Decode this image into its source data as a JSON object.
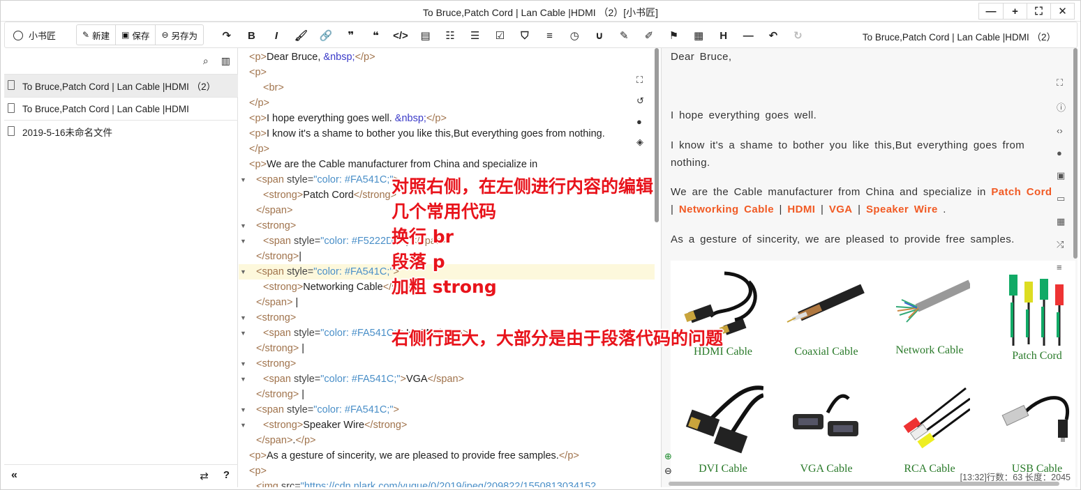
{
  "window": {
    "title": "To Bruce,Patch Cord | Lan Cable |HDMI （2）[小书匠]",
    "controls": [
      "—",
      "+",
      "⛶",
      "✕"
    ]
  },
  "toolbar": {
    "logo_label": "小书匠",
    "new_label": "新建",
    "save_label": "保存",
    "saveas_label": "另存为",
    "doc_title": "To Bruce,Patch Cord | Lan Cable |HDMI （2）",
    "tools": [
      {
        "name": "redo-arrow-icon",
        "glyph": "↷"
      },
      {
        "name": "bold-icon",
        "glyph": "B"
      },
      {
        "name": "italic-icon",
        "glyph": "I"
      },
      {
        "name": "brush-icon",
        "glyph": "🖌"
      },
      {
        "name": "link-icon",
        "glyph": "🔗"
      },
      {
        "name": "quote-icon",
        "glyph": "❞"
      },
      {
        "name": "quote-left-icon",
        "glyph": "❝"
      },
      {
        "name": "code-icon",
        "glyph": "</>"
      },
      {
        "name": "file-code-icon",
        "glyph": "▤"
      },
      {
        "name": "ordered-list-icon",
        "glyph": "☷"
      },
      {
        "name": "unordered-list-icon",
        "glyph": "☰"
      },
      {
        "name": "task-list-icon",
        "glyph": "☑"
      },
      {
        "name": "html5-icon",
        "glyph": "⛉"
      },
      {
        "name": "align-icon",
        "glyph": "≡"
      },
      {
        "name": "clock-icon",
        "glyph": "◷"
      },
      {
        "name": "magnet-icon",
        "glyph": "∪"
      },
      {
        "name": "note-edit-icon",
        "glyph": "✎"
      },
      {
        "name": "note-edit-2-icon",
        "glyph": "✐"
      },
      {
        "name": "flag-icon",
        "glyph": "⚑"
      },
      {
        "name": "table-icon",
        "glyph": "▦"
      },
      {
        "name": "heading-icon",
        "glyph": "H"
      },
      {
        "name": "horizontal-rule-icon",
        "glyph": "—"
      },
      {
        "name": "undo-icon",
        "glyph": "↶"
      },
      {
        "name": "redo-icon",
        "glyph": "↻"
      }
    ]
  },
  "sidebar": {
    "files": [
      {
        "label": "To Bruce,Patch Cord | Lan Cable |HDMI （2）",
        "active": true
      },
      {
        "label": "To Bruce,Patch Cord | Lan Cable |HDMI",
        "active": false
      },
      {
        "label": "2019-5-16未命名文件",
        "active": false
      }
    ],
    "collapse": "«",
    "swap": "⇄",
    "help": "?"
  },
  "editor": {
    "lines": [
      {
        "arrow": false,
        "indent": 0,
        "parts": [
          [
            "tag",
            "<p>"
          ],
          [
            "txt",
            "Dear Bruce, "
          ],
          [
            "ent",
            "&nbsp;"
          ],
          [
            "tag",
            "</p>"
          ]
        ]
      },
      {
        "arrow": false,
        "indent": 0,
        "parts": [
          [
            "tag",
            "<p>"
          ]
        ]
      },
      {
        "arrow": false,
        "indent": 2,
        "parts": [
          [
            "tag",
            "<br>"
          ]
        ]
      },
      {
        "arrow": false,
        "indent": 0,
        "parts": [
          [
            "tag",
            "</p>"
          ]
        ]
      },
      {
        "arrow": false,
        "indent": 0,
        "parts": [
          [
            "tag",
            "<p>"
          ],
          [
            "txt",
            "I hope everything goes well. "
          ],
          [
            "ent",
            "&nbsp;"
          ],
          [
            "tag",
            "</p>"
          ]
        ]
      },
      {
        "arrow": false,
        "indent": 0,
        "parts": [
          [
            "tag",
            "<p>"
          ],
          [
            "txt",
            "I know it's a shame to bother you like this,But everything goes from nothing."
          ]
        ]
      },
      {
        "arrow": false,
        "indent": 0,
        "parts": [
          [
            "tag",
            "</p>"
          ]
        ]
      },
      {
        "arrow": false,
        "indent": 0,
        "parts": [
          [
            "tag",
            "<p>"
          ],
          [
            "txt",
            "We are the Cable manufacturer from China and specialize in"
          ]
        ]
      },
      {
        "arrow": true,
        "indent": 1,
        "parts": [
          [
            "tag",
            "<span "
          ],
          [
            "attr",
            "style="
          ],
          [
            "str",
            "\"color: #FA541C;\""
          ],
          [
            "tag",
            ">"
          ]
        ]
      },
      {
        "arrow": false,
        "indent": 2,
        "parts": [
          [
            "tag",
            "<strong>"
          ],
          [
            "txt",
            "Patch Cord"
          ],
          [
            "tag",
            "</strong>"
          ]
        ]
      },
      {
        "arrow": false,
        "indent": 1,
        "parts": [
          [
            "tag",
            "</span>"
          ]
        ]
      },
      {
        "arrow": true,
        "indent": 1,
        "parts": [
          [
            "tag",
            "<strong>"
          ]
        ]
      },
      {
        "arrow": true,
        "indent": 2,
        "parts": [
          [
            "tag",
            "<span "
          ],
          [
            "attr",
            "style="
          ],
          [
            "str",
            "\"color: #F5222D;\""
          ],
          [
            "tag",
            ">"
          ],
          [
            "txt",
            "| "
          ],
          [
            "tag",
            "</span>"
          ]
        ]
      },
      {
        "arrow": false,
        "indent": 1,
        "parts": [
          [
            "tag",
            "</strong>"
          ],
          [
            "txt",
            "|"
          ]
        ]
      },
      {
        "arrow": true,
        "indent": 1,
        "hl": true,
        "parts": [
          [
            "tag",
            "<span "
          ],
          [
            "attr",
            "style="
          ],
          [
            "str",
            "\"color: #FA541C;\""
          ],
          [
            "tag",
            ">"
          ]
        ]
      },
      {
        "arrow": false,
        "indent": 2,
        "parts": [
          [
            "tag",
            "<strong>"
          ],
          [
            "txt",
            "Networking Cable"
          ],
          [
            "tag",
            "</strong>"
          ]
        ]
      },
      {
        "arrow": false,
        "indent": 1,
        "parts": [
          [
            "tag",
            "</span>"
          ],
          [
            "txt",
            " |"
          ]
        ]
      },
      {
        "arrow": true,
        "indent": 1,
        "parts": [
          [
            "tag",
            "<strong>"
          ]
        ]
      },
      {
        "arrow": true,
        "indent": 2,
        "parts": [
          [
            "tag",
            "<span "
          ],
          [
            "attr",
            "style="
          ],
          [
            "str",
            "\"color: #FA541C;\""
          ],
          [
            "tag",
            ">"
          ],
          [
            "txt",
            "HDMI"
          ],
          [
            "tag",
            "</span>"
          ]
        ]
      },
      {
        "arrow": false,
        "indent": 1,
        "parts": [
          [
            "tag",
            "</strong>"
          ],
          [
            "txt",
            " |"
          ]
        ]
      },
      {
        "arrow": true,
        "indent": 1,
        "parts": [
          [
            "tag",
            "<strong>"
          ]
        ]
      },
      {
        "arrow": true,
        "indent": 2,
        "parts": [
          [
            "tag",
            "<span "
          ],
          [
            "attr",
            "style="
          ],
          [
            "str",
            "\"color: #FA541C;\""
          ],
          [
            "tag",
            ">"
          ],
          [
            "txt",
            "VGA"
          ],
          [
            "tag",
            "</span>"
          ]
        ]
      },
      {
        "arrow": false,
        "indent": 1,
        "parts": [
          [
            "tag",
            "</strong>"
          ],
          [
            "txt",
            " |"
          ]
        ]
      },
      {
        "arrow": true,
        "indent": 1,
        "parts": [
          [
            "tag",
            "<span "
          ],
          [
            "attr",
            "style="
          ],
          [
            "str",
            "\"color: #FA541C;\""
          ],
          [
            "tag",
            ">"
          ]
        ]
      },
      {
        "arrow": true,
        "indent": 2,
        "parts": [
          [
            "tag",
            "<strong>"
          ],
          [
            "txt",
            "Speaker Wire"
          ],
          [
            "tag",
            "</strong>"
          ]
        ]
      },
      {
        "arrow": false,
        "indent": 1,
        "parts": [
          [
            "tag",
            "</span>"
          ],
          [
            "txt",
            "."
          ],
          [
            "tag",
            "</p>"
          ]
        ]
      },
      {
        "arrow": false,
        "indent": 0,
        "parts": [
          [
            "tag",
            "<p>"
          ],
          [
            "txt",
            "As a gesture of sincerity, we are pleased to provide free samples."
          ],
          [
            "tag",
            "</p>"
          ]
        ]
      },
      {
        "arrow": false,
        "indent": 0,
        "parts": [
          [
            "tag",
            "<p>"
          ]
        ]
      },
      {
        "arrow": false,
        "indent": 1,
        "parts": [
          [
            "tag",
            "<img "
          ],
          [
            "attr",
            "src="
          ],
          [
            "str",
            "\"https://cdn.nlark.com/yuque/0/2019/jpeg/209822/1550813034152"
          ]
        ]
      }
    ]
  },
  "preview": {
    "greeting": "Dear  Bruce,",
    "p1": "I  hope  everything  goes  well.",
    "p2a": "I  know  it's  a  shame  to  bother  you  like  this,But  everything  goes  from",
    "p2b": "nothing.",
    "p3a": "We  are  the  Cable  manufacturer  from  China  and  specialize  in",
    "links": [
      "Patch Cord",
      "Networking Cable",
      "HDMI",
      "VGA",
      "Speaker Wire"
    ],
    "p4": "As  a  gesture  of  sincerity,  we  are  pleased  to  provide  free  samples.",
    "products": [
      "HDMI Cable",
      "Coaxial Cable",
      "Network Cable",
      "Patch Cord",
      "DVI Cable",
      "VGA Cable",
      "RCA Cable",
      "USB Cable"
    ],
    "status": "[13:32]行数：63 长度：2045"
  },
  "annotations": {
    "line1": "对照右侧，在左侧进行内容的编辑",
    "line2": "几个常用代码",
    "line3": "换行 br",
    "line4": "段落 p",
    "line5": "加粗 strong",
    "line6": "右侧行距大，大部分是由于段落代码的问题"
  }
}
